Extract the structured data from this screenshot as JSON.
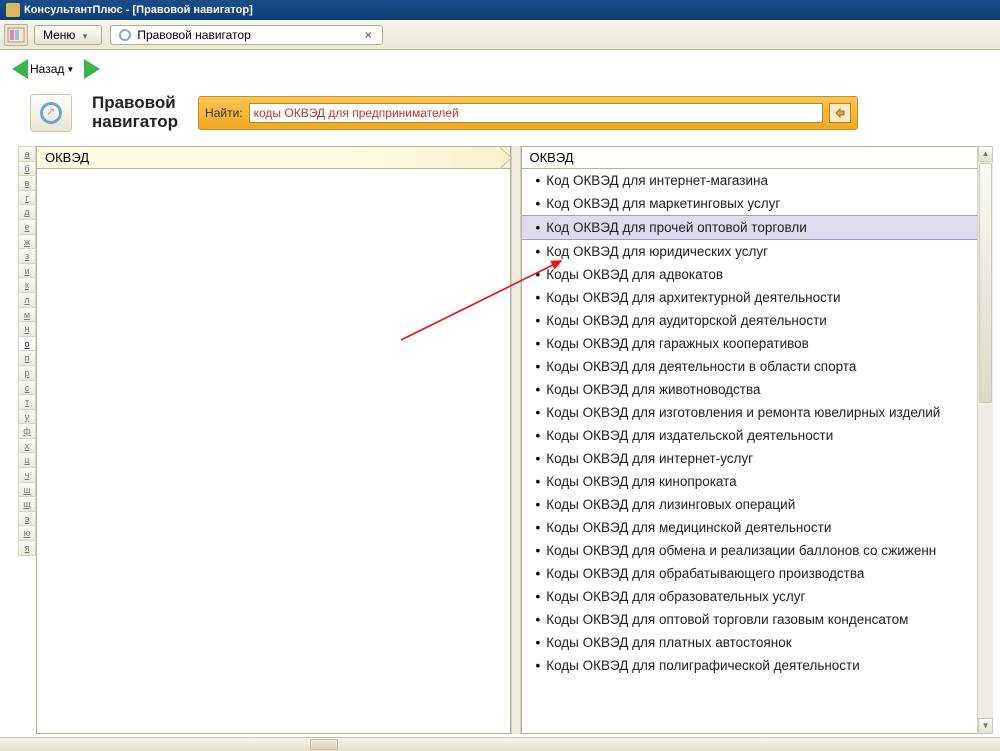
{
  "window": {
    "title": "КонсультантПлюс - [Правовой навигатор]"
  },
  "menubar": {
    "menu_label": "Меню",
    "tab_label": "Правовой навигатор"
  },
  "nav": {
    "back_label": "Назад"
  },
  "page": {
    "title_line1": "Правовой",
    "title_line2": "навигатор"
  },
  "search": {
    "label": "Найти:",
    "value": "коды ОКВЭД для предпринимателей"
  },
  "alpha": [
    "а",
    "б",
    "в",
    "г",
    "д",
    "е",
    "ж",
    "з",
    "и",
    "к",
    "л",
    "м",
    "н",
    "о",
    "п",
    "р",
    "с",
    "т",
    "у",
    "ф",
    "х",
    "ц",
    "ч",
    "ш",
    "щ",
    "э",
    "ю",
    "я"
  ],
  "alpha_active": "о",
  "left_panel": {
    "title": "ОКВЭД"
  },
  "right_panel": {
    "title": "ОКВЭД",
    "selected_index": 2,
    "items": [
      "Код ОКВЭД для интернет-магазина",
      "Код ОКВЭД для маркетинговых услуг",
      "Код ОКВЭД для прочей оптовой торговли",
      "Код ОКВЭД для юридических услуг",
      "Коды ОКВЭД для адвокатов",
      "Коды ОКВЭД для архитектурной деятельности",
      "Коды ОКВЭД для аудиторской деятельности",
      "Коды ОКВЭД для гаражных кооперативов",
      "Коды ОКВЭД для деятельности в области спорта",
      "Коды ОКВЭД для животноводства",
      "Коды ОКВЭД для изготовления и ремонта ювелирных изделий",
      "Коды ОКВЭД для издательской деятельности",
      "Коды ОКВЭД для интернет-услуг",
      "Коды ОКВЭД для кинопроката",
      "Коды ОКВЭД для лизинговых операций",
      "Коды ОКВЭД для медицинской деятельности",
      "Коды ОКВЭД для обмена и реализации баллонов со сжиженн",
      "Коды ОКВЭД для обрабатывающего производства",
      "Коды ОКВЭД для образовательных услуг",
      "Коды ОКВЭД для оптовой торговли газовым конденсатом",
      "Коды ОКВЭД для платных автостоянок",
      "Коды ОКВЭД для полиграфической деятельности"
    ]
  }
}
